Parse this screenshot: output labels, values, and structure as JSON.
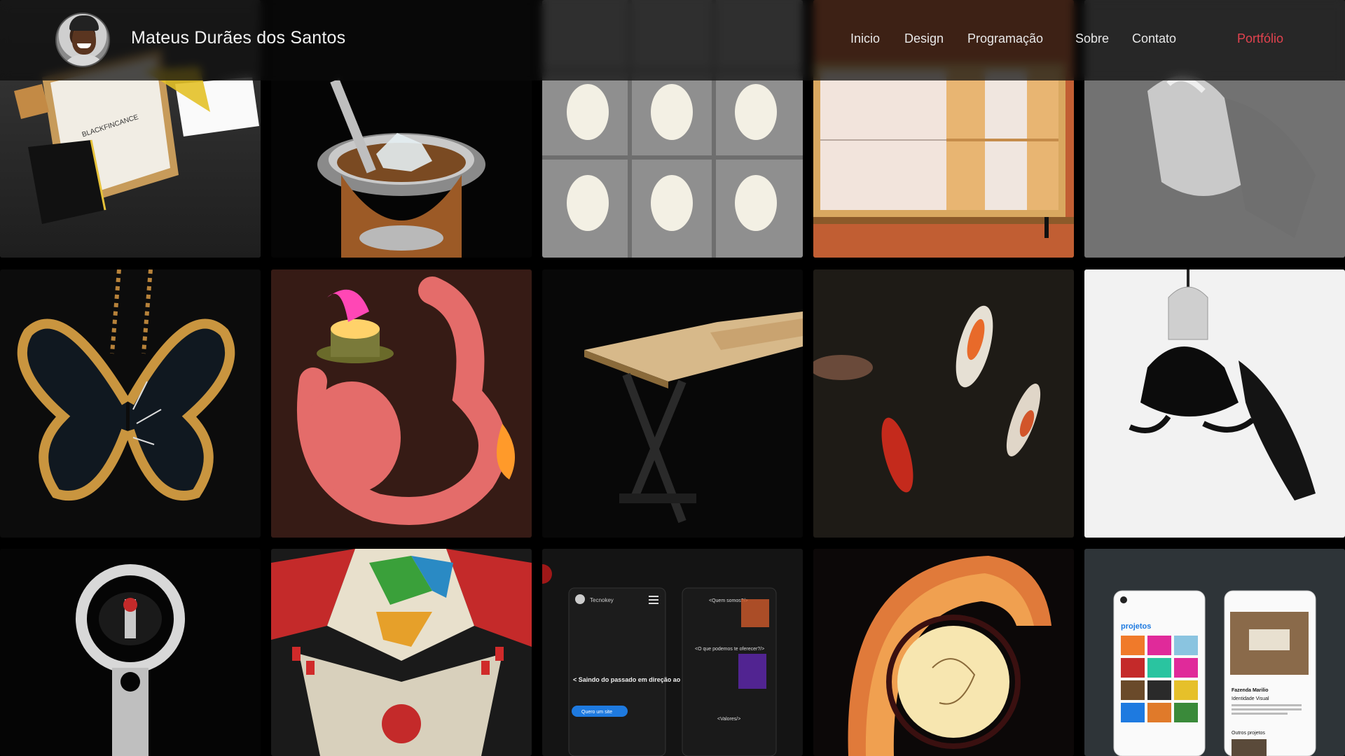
{
  "header": {
    "site_title": "Mateus Durães dos Santos",
    "avatar_icon": "profile-photo"
  },
  "nav": {
    "items": [
      {
        "label": "Inicio"
      },
      {
        "label": "Design"
      },
      {
        "label": "Programação"
      },
      {
        "label": "Sobre"
      },
      {
        "label": "Contato"
      },
      {
        "label": "Portfólio",
        "active": true
      }
    ]
  },
  "colors": {
    "accent": "#e2434f",
    "background": "#000000"
  },
  "portfolio": {
    "tiles": [
      {
        "subject": "stationery-branding"
      },
      {
        "subject": "chimarrao-cup-3d"
      },
      {
        "subject": "cobogo-wall-3d"
      },
      {
        "subject": "wood-cabinet-3d"
      },
      {
        "subject": "pencil-drawing-hands"
      },
      {
        "subject": "golden-butterfly-jewel"
      },
      {
        "subject": "pink-creature-illustration"
      },
      {
        "subject": "wood-table-3d"
      },
      {
        "subject": "koi-fish"
      },
      {
        "subject": "hummingbird-silhouette"
      },
      {
        "subject": "watch-stand-3d"
      },
      {
        "subject": "board-game-3d"
      },
      {
        "subject": "website-mockup-tecnokey"
      },
      {
        "subject": "glowing-lamp-illustration"
      },
      {
        "subject": "mobile-mockup-projetos"
      }
    ],
    "mockup_texts": {
      "tecnokey_brand": "Tecnokey",
      "tecnokey_headline": "< Saindo do passado em direção ao futuro />",
      "tecnokey_button": "Quero um site",
      "tecnokey_quem": "<Quem somos?/>",
      "tecnokey_oferecer": "<O que podemos te oferecer?/>",
      "tecnokey_valores": "<Valores/>",
      "projetos_heading": "projetos",
      "marilio_title": "Fazenda Marilio",
      "marilio_subtitle": "Identidade Visual",
      "outros_projetos": "Outros projetos",
      "stationery_brand": "BLACKFINCANCE"
    }
  }
}
